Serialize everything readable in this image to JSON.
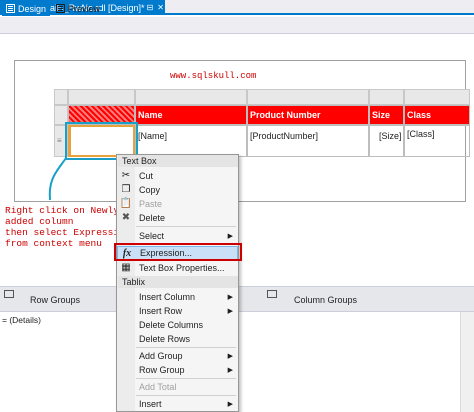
{
  "document_tab": {
    "title": "RptProdDetails_RwNo.rdl [Design]*",
    "pin_icon": "pin-icon",
    "close_icon": "close-icon"
  },
  "view_tabs": [
    {
      "label": "Design",
      "active": true
    },
    {
      "label": "Preview",
      "active": false
    }
  ],
  "report": {
    "url_text": "www.sqlskull.com"
  },
  "tablix": {
    "headers": [
      "",
      "Name",
      "Product Number",
      "Size",
      "Class"
    ],
    "data_row": [
      "",
      "[Name]",
      "[ProductNumber]",
      "[Size]",
      "[Class]"
    ],
    "header_color": "#ff0000"
  },
  "annotation": {
    "lines": [
      "Right click on Newly",
      "added column",
      "then select Expression",
      "from context menu"
    ],
    "color": "#cc0000"
  },
  "groups": {
    "row_groups_title": "Row Groups",
    "column_groups_title": "Column Groups",
    "details_item": "= (Details)"
  },
  "context_menu": {
    "textbox_header": "Text Box",
    "tablix_header": "Tablix",
    "items": {
      "cut": "Cut",
      "copy": "Copy",
      "paste": "Paste",
      "delete": "Delete",
      "select": "Select",
      "expression": "Expression...",
      "textbox_properties": "Text Box Properties...",
      "insert_column": "Insert Column",
      "insert_row": "Insert Row",
      "delete_columns": "Delete Columns",
      "delete_rows": "Delete Rows",
      "add_group": "Add Group",
      "row_group": "Row Group",
      "add_total": "Add Total",
      "insert": "Insert"
    },
    "icons": {
      "cut": "scissors-icon",
      "copy": "copy-icon",
      "paste": "paste-icon",
      "delete": "delete-x-icon",
      "expression": "fx-icon",
      "textbox_properties": "properties-icon"
    },
    "highlight_color": "#cc0000",
    "hover_color": "#c9e0f7"
  }
}
